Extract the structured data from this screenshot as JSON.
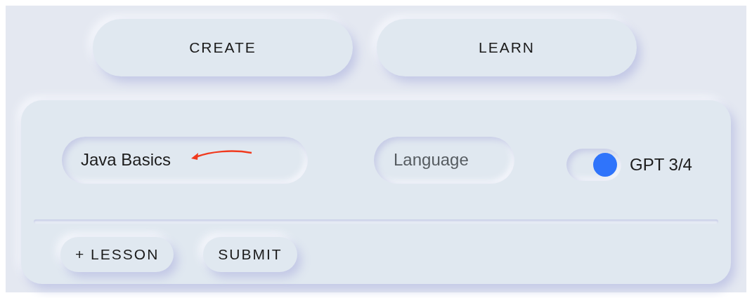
{
  "nav_buttons": [
    {
      "label": "CREATE"
    },
    {
      "label": "LEARN"
    }
  ],
  "form": {
    "title_field": {
      "value": "Java Basics"
    },
    "language_field": {
      "placeholder": "Language"
    },
    "model_toggle": {
      "on": true,
      "label": "GPT 3/4"
    }
  },
  "actions": [
    "+ LESSON",
    "SUBMIT"
  ]
}
